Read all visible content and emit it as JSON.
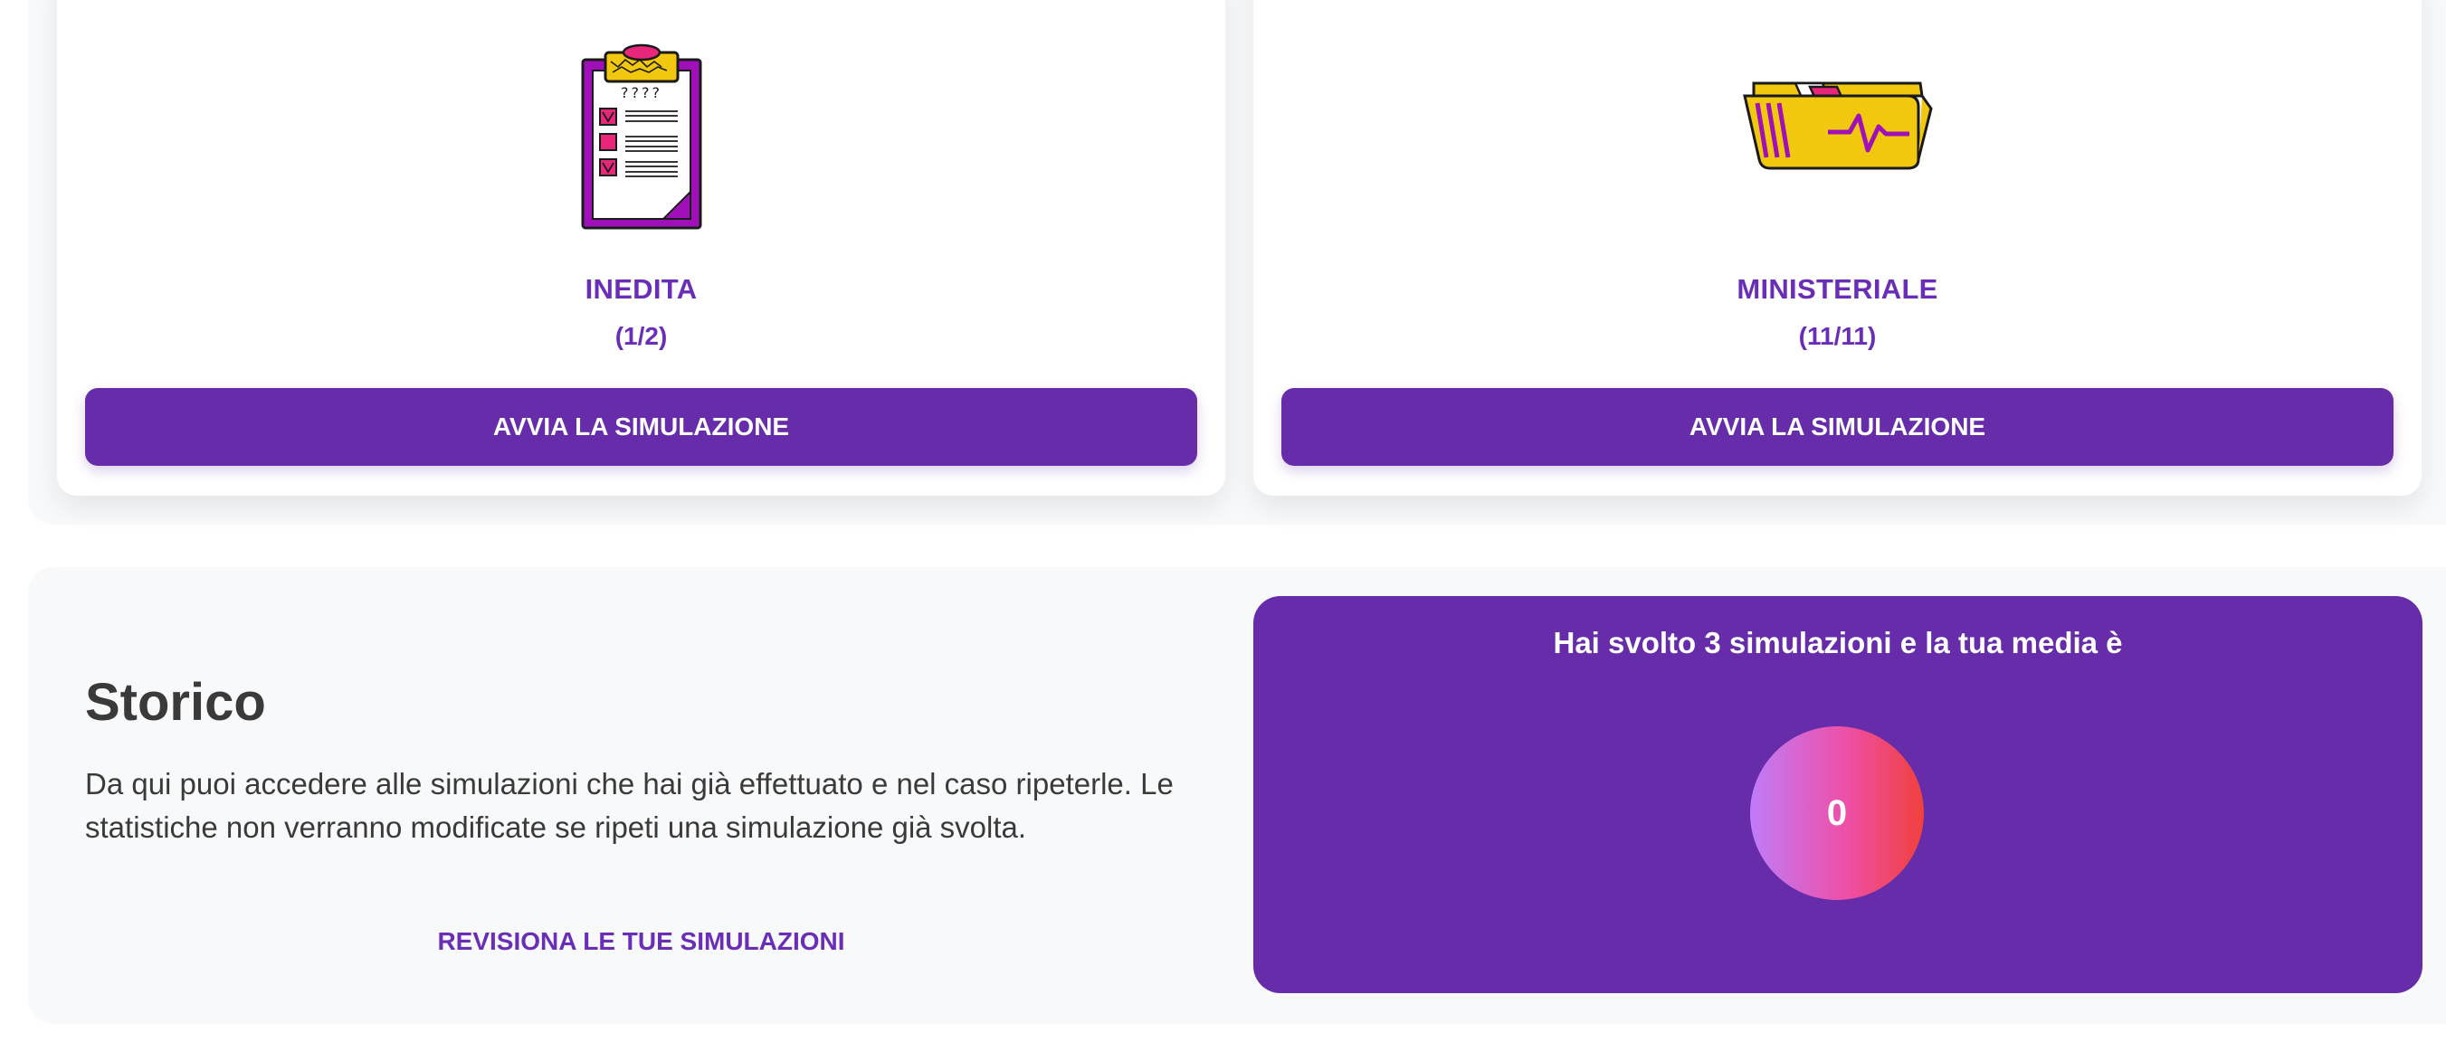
{
  "simulations": [
    {
      "title": "INEDITA",
      "count": "(1/2)",
      "button_label": "AVVIA LA SIMULAZIONE",
      "icon": "clipboard-checklist-icon",
      "icon_text": "????"
    },
    {
      "title": "MINISTERIALE",
      "count": "(11/11)",
      "button_label": "AVVIA LA SIMULAZIONE",
      "icon": "medical-folder-icon"
    }
  ],
  "history": {
    "title": "Storico",
    "description": "Da qui puoi accedere alle simulazioni che hai già effettuato e nel caso ripeterle. Le statistiche non verranno modificate se ripeti una simulazione già svolta.",
    "link_label": "REVISIONA LE TUE SIMULAZIONI"
  },
  "stats": {
    "text": "Hai svolto 3 simulazioni e la tua media è",
    "score": "0"
  },
  "colors": {
    "primary": "#662ca9",
    "title_purple": "#6a2db8",
    "panel_background": "#f8f9fa",
    "text": "#3a3a3a",
    "icon_magenta": "#a010b8",
    "icon_yellow": "#f2c80f",
    "icon_pink": "#e8267a"
  }
}
